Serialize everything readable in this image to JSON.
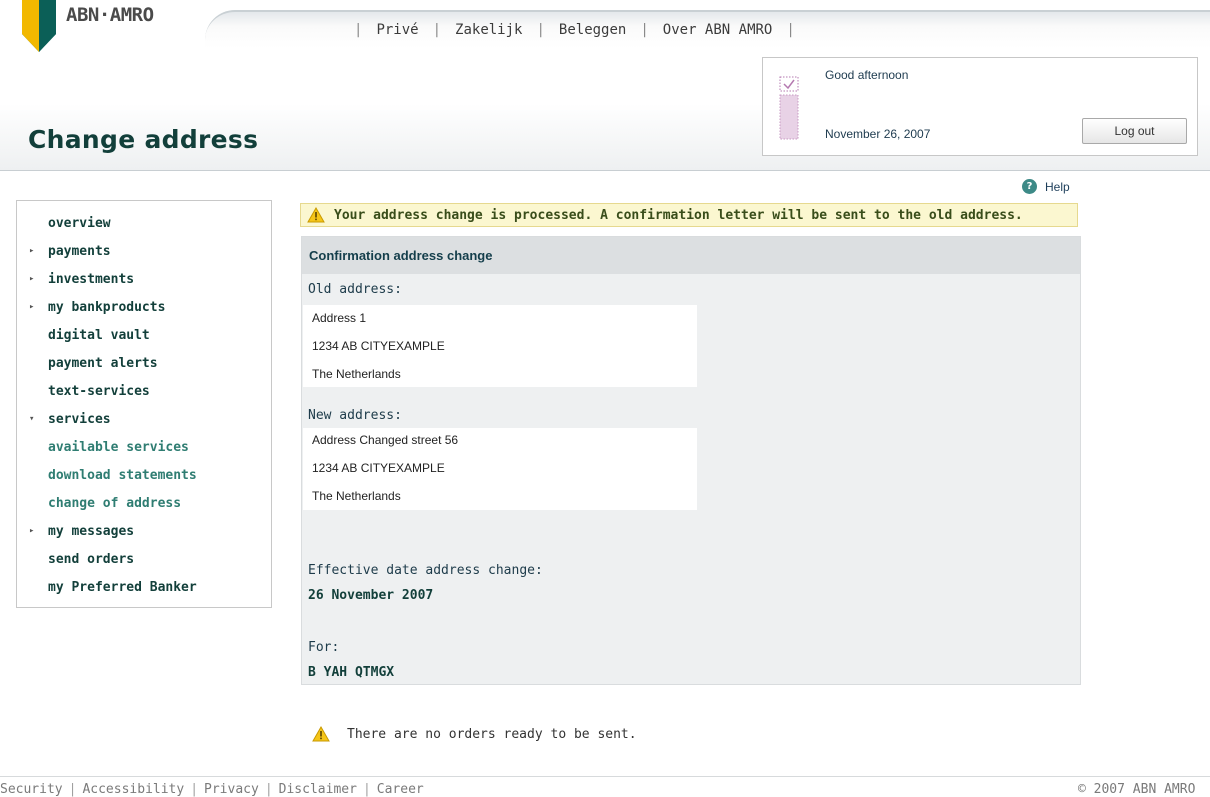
{
  "brand": {
    "name": "ABN·AMRO"
  },
  "topnav": {
    "items": [
      "Privé",
      "Zakelijk",
      "Beleggen",
      "Over ABN AMRO"
    ]
  },
  "header": {
    "title": "Change address"
  },
  "session": {
    "greeting": "Good afternoon",
    "date": "November 26, 2007",
    "logout_label": "Log out"
  },
  "help": {
    "label": "Help"
  },
  "sidebar": {
    "items": [
      {
        "label": "overview"
      },
      {
        "label": "payments"
      },
      {
        "label": "investments"
      },
      {
        "label": "my bankproducts"
      },
      {
        "label": "digital vault"
      },
      {
        "label": "payment alerts"
      },
      {
        "label": "text-services"
      },
      {
        "label": "services"
      },
      {
        "label": "available services"
      },
      {
        "label": "download statements"
      },
      {
        "label": "change of address"
      },
      {
        "label": "my messages"
      },
      {
        "label": "send orders"
      },
      {
        "label": "my Preferred Banker"
      }
    ]
  },
  "alert": {
    "text": "Your address change is processed. A confirmation letter will be sent to the old address."
  },
  "confirmation": {
    "title": "Confirmation address change",
    "old_label": "Old address:",
    "old_address": [
      "Address 1",
      "1234 AB  CITYEXAMPLE",
      "The Netherlands"
    ],
    "new_label": "New address:",
    "new_address": [
      "Address Changed street 56",
      "1234 AB  CITYEXAMPLE",
      "The Netherlands"
    ],
    "effective_label": "Effective date address change:",
    "effective_date": "26 November 2007",
    "for_label": "For:",
    "for_value": "B YAH QTMGX"
  },
  "orders_note": "There are no orders ready to be sent.",
  "footer": {
    "links": [
      "Security",
      "Accessibility",
      "Privacy",
      "Disclaimer",
      "Career"
    ],
    "copyright": "© 2007 ABN AMRO"
  },
  "colors": {
    "brand_dark_green": "#123f3a",
    "brand_teal": "#2f7d72",
    "alert_bg": "#fbf7d0",
    "logo_yellow": "#f2b800"
  }
}
